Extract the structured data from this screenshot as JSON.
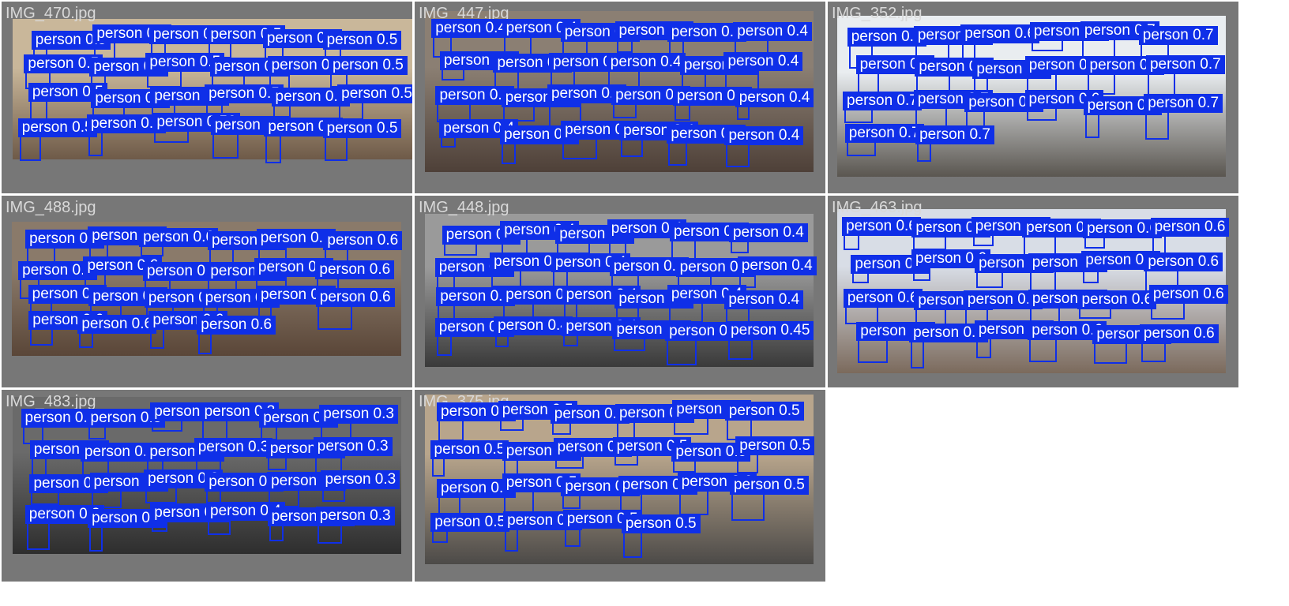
{
  "colors": {
    "background": "#ffffff",
    "panel": "#777777",
    "box": "#0f2fe8",
    "label_text": "#ffffff",
    "filename_text": "#d9d9d9"
  },
  "class_name": "person",
  "panels": [
    {
      "filename": "IMG_470.jpg",
      "photo": {
        "sky": "#c9b79a",
        "ground": "#6e5a48"
      },
      "scores": [
        "0.5",
        "0.5",
        "0.5",
        "0.5",
        "0.5",
        "0.5",
        "0.5",
        "0.5",
        "0.5",
        "0.5",
        "0.5",
        "0.5",
        "0.5",
        "0.5",
        "0.5",
        "0.5",
        "0.5",
        "0.5",
        "0.5",
        "0.5",
        "0.56",
        "0.5",
        "0.5",
        "0.5"
      ]
    },
    {
      "filename": "IMG_447.jpg",
      "photo": {
        "sky": "#8b7f73",
        "ground": "#4e4038"
      },
      "scores": [
        "0.4",
        "0.4",
        "0.4",
        "0.4",
        "0.4",
        "0.4",
        "0.4",
        "0.4",
        "0.4",
        "0.4",
        "0.4",
        "0.4",
        "0.4",
        "0.4",
        "0.4",
        "0.4",
        "0.4",
        "0.4",
        "0.4",
        "0.4",
        "0.4",
        "0.4",
        "0.4",
        "0.4"
      ]
    },
    {
      "filename": "IMG_352.jpg",
      "photo": {
        "sky": "#e9edf0",
        "ground": "#5a5650"
      },
      "scores": [
        "0.7",
        "0.6",
        "0.6",
        "0.7",
        "0.7",
        "0.7",
        "0.7",
        "0.6",
        "0.7",
        "0.7",
        "0.7",
        "0.7",
        "0.7",
        "0.7",
        "0.7",
        "0.6",
        "0.7",
        "0.7",
        "0.7",
        "0.7"
      ]
    },
    {
      "filename": "IMG_488.jpg",
      "photo": {
        "sky": "#8a7a6a",
        "ground": "#5a4638"
      },
      "scores": [
        "0.6",
        "0.6",
        "0.6",
        "0.6",
        "0.6",
        "0.6",
        "0.6",
        "0.6",
        "0.6",
        "0.6",
        "0.6",
        "0.6",
        "0.6",
        "0.6",
        "0.6",
        "0.6",
        "0.6",
        "0.6",
        "0.6",
        "0.6",
        "0.6",
        "0.6"
      ]
    },
    {
      "filename": "IMG_448.jpg",
      "photo": {
        "sky": "#9a9a9a",
        "ground": "#3a3a3a"
      },
      "scores": [
        "0.6",
        "0.4",
        "0.4",
        "0.4",
        "0.4",
        "0.4",
        "0.4",
        "0.4",
        "0.4",
        "0.4",
        "0.4",
        "0.4",
        "0.4",
        "0.4",
        "0.4",
        "0.4",
        "0.4",
        "0.4",
        "0.4",
        "0.4",
        "0.4",
        "0.4",
        "0.44",
        "0.45"
      ]
    },
    {
      "filename": "IMG_463.jpg",
      "photo": {
        "sky": "#d8dde6",
        "ground": "#7b6a5c"
      },
      "scores": [
        "0.6",
        "0.5",
        "0.5",
        "0.6",
        "0.6",
        "0.6",
        "0.6",
        "0.6",
        "0.6",
        "0.6",
        "0.6",
        "0.6",
        "0.6",
        "0.6",
        "0.6",
        "0.6",
        "0.6",
        "0.6",
        "0.6",
        "0.6",
        "0.6",
        "0.6",
        "0.6",
        "0.6"
      ]
    },
    {
      "filename": "IMG_483.jpg",
      "photo": {
        "sky": "#6a6a6a",
        "ground": "#2e2e2e"
      },
      "scores": [
        "0.3",
        "0.3",
        "0.3",
        "0.3",
        "0.3",
        "0.3",
        "0.3",
        "0.3",
        "0.3",
        "0.3",
        "0.3",
        "0.3",
        "0.3",
        "0.3",
        "0.3",
        "0.4",
        "0.3",
        "0.3",
        "0.3",
        "0.3",
        "0.3",
        "0.4",
        "0.44",
        "0.3"
      ]
    },
    {
      "filename": "IMG_375.jpg",
      "photo": {
        "sky": "#b8a58c",
        "ground": "#4c4a48"
      },
      "scores": [
        "0.5",
        "0.5",
        "0.5",
        "0.5",
        "0.5",
        "0.5",
        "0.5",
        "0.5",
        "0.5",
        "0.5",
        "0.5",
        "0.5",
        "0.5",
        "0.5",
        "0.6",
        "0.6",
        "0.6",
        "0.5",
        "0.5",
        "0.5",
        "0.5",
        "0.5"
      ]
    }
  ]
}
